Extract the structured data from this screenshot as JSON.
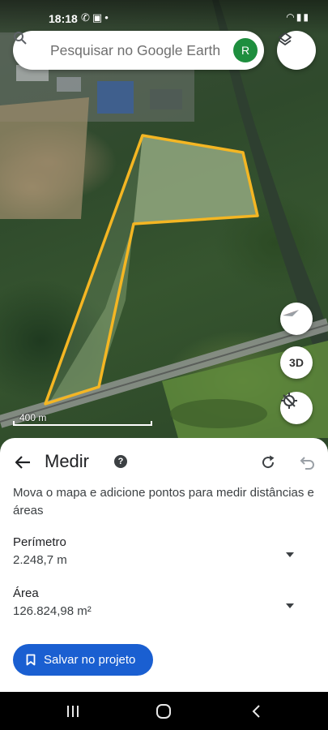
{
  "status_bar": {
    "time": "18:18",
    "notification_icons": [
      "whatsapp-icon",
      "msg-icon",
      "dot-icon"
    ],
    "system_icons": [
      "wifi-icon",
      "signal-icon",
      "battery-icon"
    ]
  },
  "search": {
    "placeholder": "Pesquisar no Google Earth",
    "avatar_letter": "R"
  },
  "map": {
    "scale_label": "400 m",
    "view_3d_label": "3D"
  },
  "measure_panel": {
    "title": "Medir",
    "instructions": "Mova o mapa e adicione pontos para medir distâncias e áreas",
    "perimeter_label": "Perímetro",
    "perimeter_value": "2.248,7 m",
    "area_label": "Área",
    "area_value": "126.824,98 m²",
    "save_button": "Salvar no projeto"
  },
  "colors": {
    "polygon_stroke": "#f4b623",
    "save_button_bg": "#1a5fd1",
    "avatar_bg": "#1e8e3e"
  }
}
